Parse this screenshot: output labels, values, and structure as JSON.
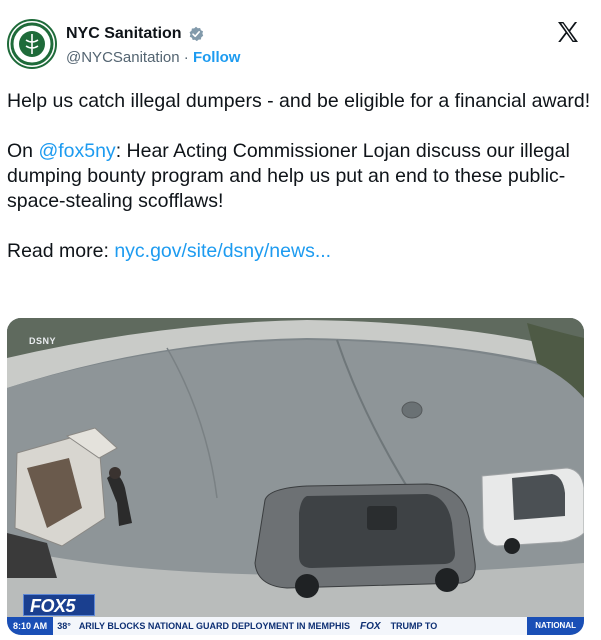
{
  "account": {
    "display_name": "NYC Sanitation",
    "handle": "@NYCSanitation",
    "separator": " · ",
    "follow_label": "Follow",
    "avatar_icon": "nyc-sanitation-seal",
    "verified_icon": "verified-badge-icon",
    "verified_color": "#829aab"
  },
  "platform": {
    "logo_icon": "x-logo-icon"
  },
  "tweet": {
    "line1": "Help us catch illegal dumpers - and be eligible for a financial award!",
    "p2_prefix": "On ",
    "p2_mention": "@fox5ny",
    "p2_rest": ": Hear Acting Commissioner Lojan discuss our illegal dumping bounty program and help us put an end to these public-space-stealing scofflaws!",
    "p3_prefix": "Read more: ",
    "p3_link": "nyc.gov/site/dsny/news..."
  },
  "media": {
    "watermark": "DSNY",
    "channel_logo": "FOX5",
    "ticker": {
      "time": "8:10 AM",
      "temp": "38°",
      "headline": "ARILY BLOCKS NATIONAL GUARD DEPLOYMENT IN MEMPHIS",
      "fox": "FOX",
      "next": "TRUMP TO",
      "section": "NATIONAL"
    }
  },
  "colors": {
    "link": "#1d9bf0",
    "text": "#0f1419",
    "muted": "#536471",
    "fox_blue": "#1a3f8f"
  }
}
